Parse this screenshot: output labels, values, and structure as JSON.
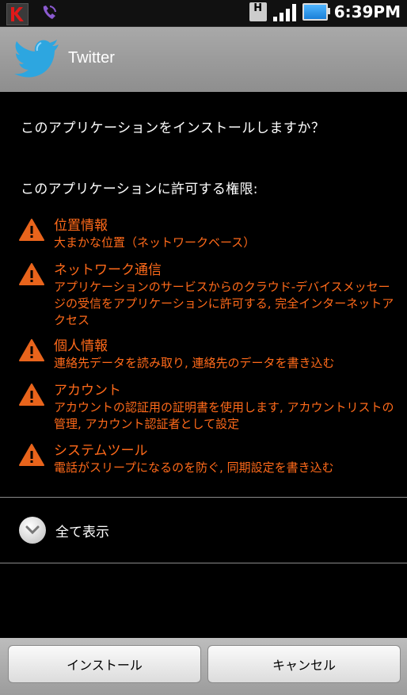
{
  "status_bar": {
    "time": "6:39PM",
    "network_badge": "H",
    "icons": [
      "kaspersky-icon",
      "viber-icon",
      "h-network-icon",
      "signal-icon",
      "battery-icon"
    ]
  },
  "app": {
    "title": "Twitter",
    "icon": "twitter-bird-icon"
  },
  "install": {
    "question": "このアプリケーションをインストールしますか？",
    "permissions_header": "このアプリケーションに許可する権限:",
    "permissions": [
      {
        "title": "位置情報",
        "description": "大まかな位置（ネットワークベース）"
      },
      {
        "title": "ネットワーク通信",
        "description": "アプリケーションのサービスからのクラウド-デバイスメッセージの受信をアプリケーションに許可する, 完全インターネットアクセス"
      },
      {
        "title": "個人情報",
        "description": "連絡先データを読み取り, 連絡先のデータを書き込む"
      },
      {
        "title": "アカウント",
        "description": "アカウントの認証用の証明書を使用します, アカウントリストの管理, アカウント認証者として設定"
      },
      {
        "title": "システムツール",
        "description": "電話がスリープになるのを防ぐ, 同期設定を書き込む"
      }
    ],
    "show_all_label": "全て表示"
  },
  "buttons": {
    "install": "インストール",
    "cancel": "キャンセル"
  },
  "colors": {
    "permission_text": "#ff6a1a",
    "warning_icon": "#e8641c",
    "background": "#000000"
  }
}
